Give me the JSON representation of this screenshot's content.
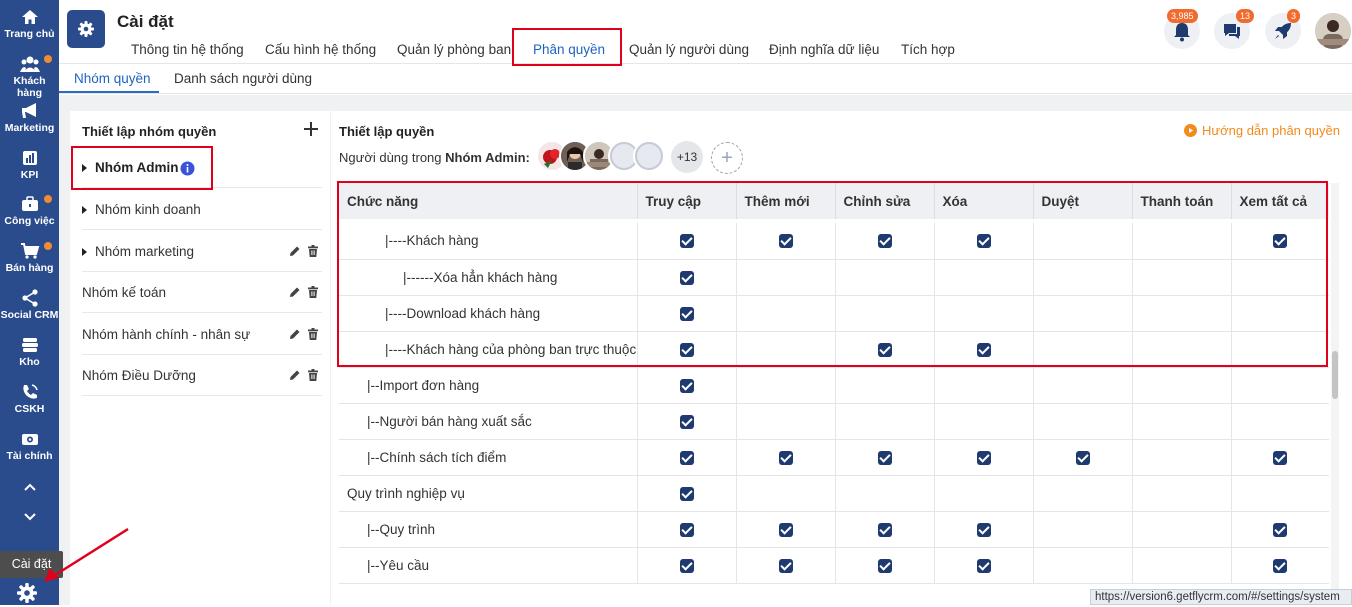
{
  "sidebar": {
    "items": [
      {
        "label": "Trang chủ",
        "icon": "home-icon"
      },
      {
        "label": "Khách hàng",
        "icon": "customers-icon"
      },
      {
        "label": "Marketing",
        "icon": "megaphone-icon"
      },
      {
        "label": "KPI",
        "icon": "chart-icon"
      },
      {
        "label": "Công việc",
        "icon": "briefcase-icon"
      },
      {
        "label": "Bán hàng",
        "icon": "cart-icon"
      },
      {
        "label": "Social CRM",
        "icon": "share-icon"
      },
      {
        "label": "Kho",
        "icon": "warehouse-icon"
      },
      {
        "label": "CSKH",
        "icon": "phone-icon"
      },
      {
        "label": "Tài chính",
        "icon": "finance-icon"
      }
    ],
    "tooltip": "Cài đặt"
  },
  "header": {
    "title": "Cài đặt",
    "tabs": [
      "Thông tin hệ thống",
      "Cấu hình hệ thống",
      "Quản lý phòng ban",
      "Phân quyền",
      "Quản lý người dùng",
      "Định nghĩa dữ liệu",
      "Tích hợp"
    ],
    "active_tab": "Phân quyền",
    "badges": {
      "notifications": "3,985",
      "messages": "13",
      "rocket": "3"
    }
  },
  "subtabs": [
    "Nhóm quyền",
    "Danh sách người dùng"
  ],
  "left_panel": {
    "title": "Thiết lập nhóm quyền",
    "groups": [
      "Nhóm Admin",
      "Nhóm kinh doanh",
      "Nhóm marketing",
      "Nhóm kế toán",
      "Nhóm hành chính - nhân sự",
      "Nhóm Điều Dưỡng"
    ]
  },
  "right_panel": {
    "title": "Thiết lập quyền",
    "help_link": "Hướng dẫn phân quyền",
    "users_label_prefix": "Người dùng trong ",
    "users_label_group": "Nhóm Admin:",
    "more_users": "+13",
    "add_user": "+"
  },
  "permissions": {
    "columns": [
      "Chức năng",
      "Truy cập",
      "Thêm mới",
      "Chỉnh sửa",
      "Xóa",
      "Duyệt",
      "Thanh toán",
      "Xem tất cả"
    ],
    "rows": [
      {
        "name": "|----Khách hàng",
        "indent": 2,
        "checks": [
          1,
          1,
          1,
          1,
          0,
          0,
          1
        ]
      },
      {
        "name": "|------Xóa hẳn khách hàng",
        "indent": 3,
        "checks": [
          1,
          0,
          0,
          0,
          0,
          0,
          0
        ]
      },
      {
        "name": "|----Download khách hàng",
        "indent": 2,
        "checks": [
          1,
          0,
          0,
          0,
          0,
          0,
          0
        ]
      },
      {
        "name": "|----Khách hàng của phòng ban trực thuộc",
        "indent": 2,
        "checks": [
          1,
          0,
          1,
          1,
          0,
          0,
          0
        ]
      },
      {
        "name": "|--Import đơn hàng",
        "indent": 1,
        "checks": [
          1,
          0,
          0,
          0,
          0,
          0,
          0
        ]
      },
      {
        "name": "|--Người bán hàng xuất sắc",
        "indent": 1,
        "checks": [
          1,
          0,
          0,
          0,
          0,
          0,
          0
        ]
      },
      {
        "name": "|--Chính sách tích điểm",
        "indent": 1,
        "checks": [
          1,
          1,
          1,
          1,
          1,
          0,
          1
        ]
      },
      {
        "name": "Quy trình nghiệp vụ",
        "indent": 0,
        "checks": [
          1,
          0,
          0,
          0,
          0,
          0,
          0
        ]
      },
      {
        "name": "|--Quy trình",
        "indent": 1,
        "checks": [
          1,
          1,
          1,
          1,
          0,
          0,
          1
        ]
      },
      {
        "name": "|--Yêu cầu",
        "indent": 1,
        "checks": [
          1,
          1,
          1,
          1,
          0,
          0,
          1
        ]
      }
    ]
  },
  "status_url": "https://version6.getflycrm.com/#/settings/system"
}
